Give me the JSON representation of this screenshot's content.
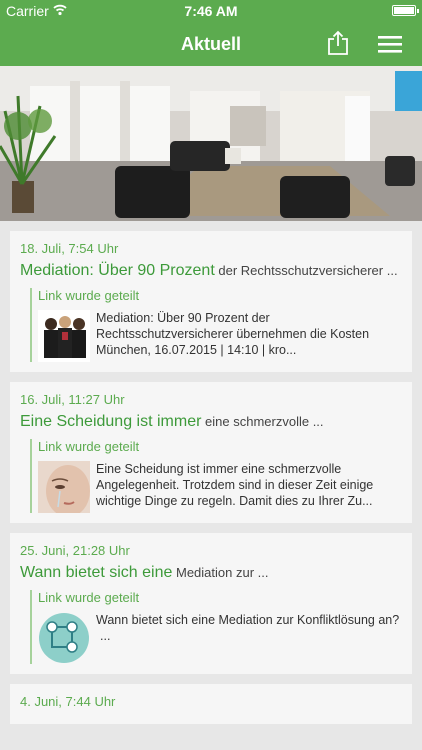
{
  "status": {
    "carrier": "Carrier",
    "time": "7:46 AM"
  },
  "nav": {
    "title": "Aktuell",
    "share_icon": "share-icon",
    "menu_icon": "hamburger-menu-icon"
  },
  "colors": {
    "brand_green": "#5cab4f",
    "title_green": "#3d9a3a"
  },
  "posts": [
    {
      "date": "18. Juli, 7:54 Uhr",
      "title": "Mediation: Über 90 Prozent",
      "title_rest": " der Rechtsschutzversicherer ...",
      "shared_label": "Link wurde geteilt",
      "excerpt": "Mediation: Über 90 Prozent der Rechtsschutzversicherer übernehmen die Kosten München, 16.07.2015 | 14:10 | kro..."
    },
    {
      "date": "16. Juli, 11:27 Uhr",
      "title": "Eine Scheidung ist immer",
      "title_rest": " eine schmerzvolle ...",
      "shared_label": "Link wurde geteilt",
      "excerpt": "Eine Scheidung ist immer eine schmerzvolle Angelegenheit. Trotzdem sind in dieser Zeit einige wichtige Dinge zu regeln. Damit dies zu Ihrer Zu..."
    },
    {
      "date": "25. Juni, 21:28 Uhr",
      "title": "Wann bietet sich eine",
      "title_rest": " Mediation zur ...",
      "shared_label": "Link wurde geteilt",
      "excerpt": "Wann bietet sich eine Mediation zur Konfliktlösung an?",
      "excerpt_more": "..."
    },
    {
      "date": "4. Juni, 7:44 Uhr"
    }
  ]
}
